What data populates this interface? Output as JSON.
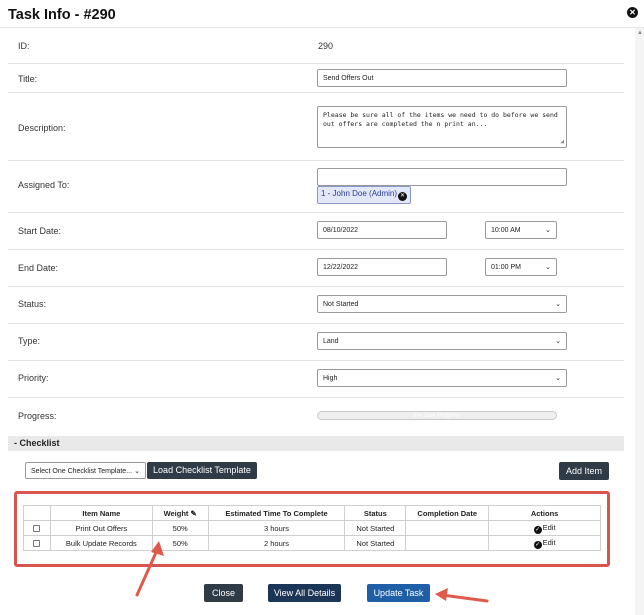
{
  "window": {
    "title": "Task Info - #290"
  },
  "fields": {
    "id_label": "ID:",
    "id_value": "290",
    "title_label": "Title:",
    "title_value": "Send Offers Out",
    "description_label": "Description:",
    "description_line1": "Please be sure all of the items we need to do before we send",
    "description_line2": "out offers are completed the n print an...",
    "assigned_label": "Assigned To:",
    "assigned_chip": "1 - John Doe (Admin)",
    "start_label": "Start Date:",
    "start_date": "08/10/2022",
    "start_time": "10:00 AM",
    "end_label": "End Date:",
    "end_date": "12/22/2022",
    "end_time": "01:00 PM",
    "status_label": "Status:",
    "status_value": "Not Started",
    "type_label": "Type:",
    "type_value": "Land",
    "priority_label": "Priority:",
    "priority_value": "High",
    "progress_label": "Progress:",
    "progress_text": "0% Task Progress",
    "progress_percent": 0
  },
  "checklist": {
    "heading": "- Checklist",
    "template_select": "Select One Checklist Template...",
    "load_button": "Load Checklist Template",
    "add_button": "Add Item",
    "columns": {
      "blank": "",
      "item_name": "Item Name",
      "weight": "Weight",
      "estimated": "Estimated Time To Complete",
      "status": "Status",
      "completion": "Completion Date",
      "actions": "Actions"
    },
    "rows": [
      {
        "name": "Print Out Offers",
        "weight": "50%",
        "estimated": "3 hours",
        "status": "Not Started",
        "completion": "",
        "action": "Edit"
      },
      {
        "name": "Bulk Update Records",
        "weight": "50%",
        "estimated": "2 hours",
        "status": "Not Started",
        "completion": "",
        "action": "Edit"
      }
    ]
  },
  "footer": {
    "close": "Close",
    "view_all": "View All Details",
    "update": "Update Task"
  },
  "colors": {
    "annotation_red": "#d9534f",
    "button_dark": "#2f3b47",
    "button_blue": "#1f5fa8",
    "chip_bg": "#e3e8f9"
  },
  "icons": [
    "close-icon",
    "chevron-down-icon",
    "pencil-icon",
    "check-circle-icon",
    "remove-chip-icon",
    "arrow-annotation"
  ]
}
